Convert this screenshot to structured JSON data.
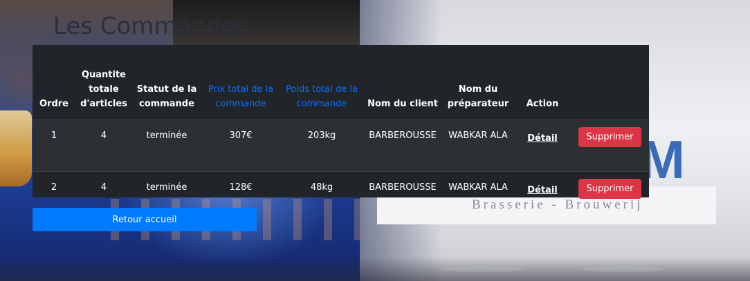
{
  "page": {
    "title": "Les Commandes"
  },
  "table": {
    "headers": [
      {
        "label": "Ordre",
        "style": "plain"
      },
      {
        "label": "Quantite totale d'articles",
        "style": "plain"
      },
      {
        "label": "Statut de la commande",
        "style": "plain"
      },
      {
        "label": "Prix total de la commande",
        "style": "link"
      },
      {
        "label": "Poids total de la commande",
        "style": "link"
      },
      {
        "label": "Nom du client",
        "style": "plain"
      },
      {
        "label": "Nom du préparateur",
        "style": "plain"
      },
      {
        "label": "Action",
        "style": "plain"
      },
      {
        "label": "",
        "style": "plain"
      }
    ],
    "rows": [
      {
        "ordre": "1",
        "quantite": "4",
        "statut": "terminée",
        "prix": "307€",
        "poids": "203kg",
        "client": "BARBEROUSSE",
        "preparateur": "WABKAR ALA",
        "detail_label": "Détail",
        "delete_label": "Supprimer"
      },
      {
        "ordre": "2",
        "quantite": "4",
        "statut": "terminée",
        "prix": "128€",
        "poids": "48kg",
        "client": "BARBEROUSSE",
        "preparateur": "WABKAR ALA",
        "detail_label": "Détail",
        "delete_label": "Supprimer"
      }
    ]
  },
  "actions": {
    "home_label": "Retour accueil"
  },
  "background": {
    "logo_letter": "M",
    "banner_text": "Brasserie - Brouwerij"
  },
  "colors": {
    "table_bg": "#212529",
    "link_header": "#0d6efd",
    "delete_button": "#dc3545",
    "home_button": "#007bff"
  }
}
